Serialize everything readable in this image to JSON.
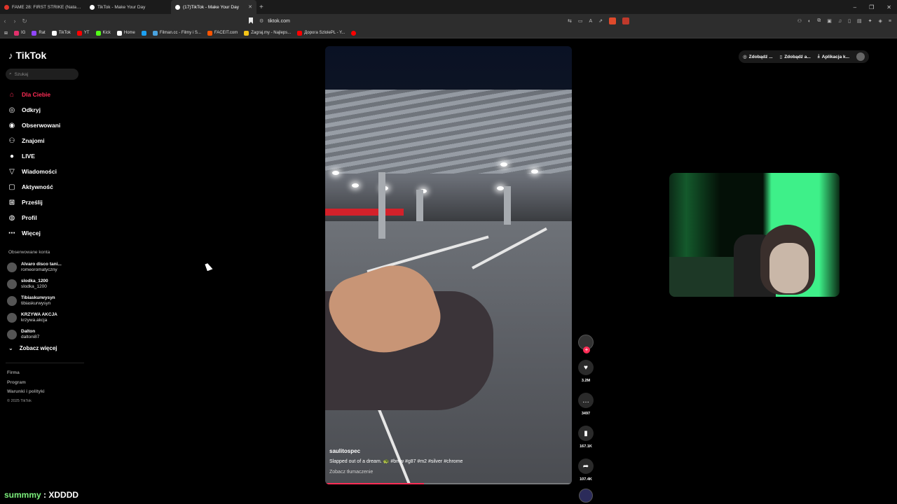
{
  "browser": {
    "tabs": [
      {
        "title": "FAME 28: FIRST STRIKE (Natan Marc...",
        "fav_color": "#e0352b"
      },
      {
        "title": "TikTok - Make Your Day",
        "fav_color": "#ffffff"
      },
      {
        "title": "(17)TikTok - Make Your Day",
        "fav_color": "#ffffff",
        "active": true
      }
    ],
    "url": "tiktok.com",
    "bookmarks": [
      {
        "label": "IG",
        "color": "#e1306c"
      },
      {
        "label": "Rat",
        "color": "#9146ff"
      },
      {
        "label": "TikTok",
        "color": "#ffffff"
      },
      {
        "label": "YT",
        "color": "#ff0000"
      },
      {
        "label": "Kick",
        "color": "#53fc18"
      },
      {
        "label": "Home",
        "color": "#ffffff"
      },
      {
        "label": "",
        "color": "#1da1f2"
      },
      {
        "label": "Filman.cc - Filmy i S...",
        "color": "#4aa3df"
      },
      {
        "label": "FACEIT.com",
        "color": "#ff5500"
      },
      {
        "label": "Zagraj.my - Najleps...",
        "color": "#f5c518"
      },
      {
        "label": "Дорога SzlolePL - Y...",
        "color": "#ff0000"
      },
      {
        "label": "",
        "color": "#ff0000"
      }
    ]
  },
  "sidebar": {
    "logo": "TikTok",
    "search_placeholder": "Szukaj",
    "nav": [
      {
        "label": "Dla Ciebie",
        "icon": "home-icon",
        "active": true
      },
      {
        "label": "Odkryj",
        "icon": "compass-icon"
      },
      {
        "label": "Obserwowani",
        "icon": "following-icon"
      },
      {
        "label": "Znajomi",
        "icon": "friends-icon"
      },
      {
        "label": "LIVE",
        "icon": "live-icon"
      },
      {
        "label": "Wiadomości",
        "icon": "message-icon"
      },
      {
        "label": "Aktywność",
        "icon": "activity-icon"
      },
      {
        "label": "Prześlij",
        "icon": "upload-icon"
      },
      {
        "label": "Profil",
        "icon": "profile-icon"
      },
      {
        "label": "Więcej",
        "icon": "more-icon"
      }
    ],
    "followed_label": "Obserwowane konta",
    "followed": [
      {
        "name": "Alvaro disco tani...",
        "handle": "romeoromatyczny"
      },
      {
        "name": "slodka_1200",
        "handle": "slodka_1200"
      },
      {
        "name": "Tibiaskurwysyn",
        "handle": "tibiaskurwysyn"
      },
      {
        "name": "KRZYWA AKCJA",
        "handle": "krzywa.akcja"
      },
      {
        "name": "Dalton",
        "handle": "daltoni87"
      }
    ],
    "see_more": "Zobacz więcej",
    "footer": [
      "Firma",
      "Program",
      "Warunki i polityki"
    ],
    "copyright": "© 2025 TikTok"
  },
  "video": {
    "author": "saulitospec",
    "description": "Slapped out of a dream. 🐢 #bmw #g87 #m2 #silver #chrome",
    "translate": "Zobacz tłumaczenie",
    "progress": 0.4
  },
  "actions": {
    "likes": "3.2M",
    "comments": "3497",
    "saves": "167.1K",
    "shares": "107.4K"
  },
  "topbar": {
    "btn1": "Zdobądź ...",
    "btn2": "Zdobądź a...",
    "btn3": "Aplikacja k..."
  },
  "chat": {
    "name": "summmy",
    "message": " : XDDDD"
  }
}
